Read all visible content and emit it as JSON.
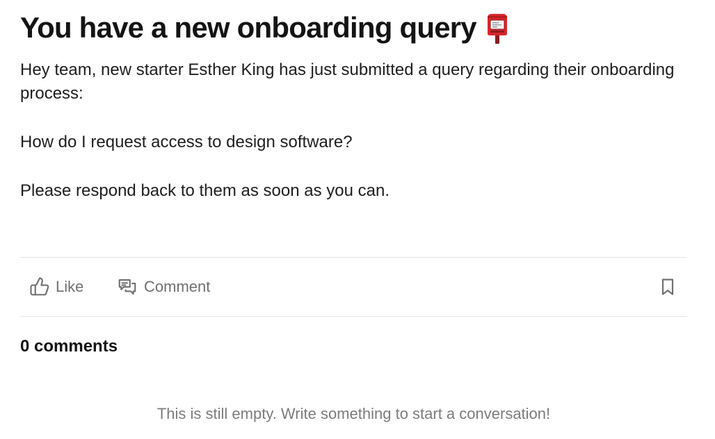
{
  "post": {
    "title": "You have a new onboarding query",
    "title_icon": "postbox-icon",
    "intro": "Hey team, new starter Esther King has just submitted a query regarding their onboarding process:",
    "question": "How do I request access to design software?",
    "closing": "Please respond back to them as soon as you can."
  },
  "actions": {
    "like_label": "Like",
    "comment_label": "Comment",
    "like_icon": "thumbs-up-icon",
    "comment_icon": "chat-bubbles-icon",
    "bookmark_icon": "bookmark-icon"
  },
  "comments": {
    "heading": "0 comments",
    "empty_message": "This is still empty. Write something to start a conversation!"
  },
  "colors": {
    "postbox_red": "#d9262c",
    "action_gray": "#707070",
    "divider": "#e6e6e6"
  }
}
